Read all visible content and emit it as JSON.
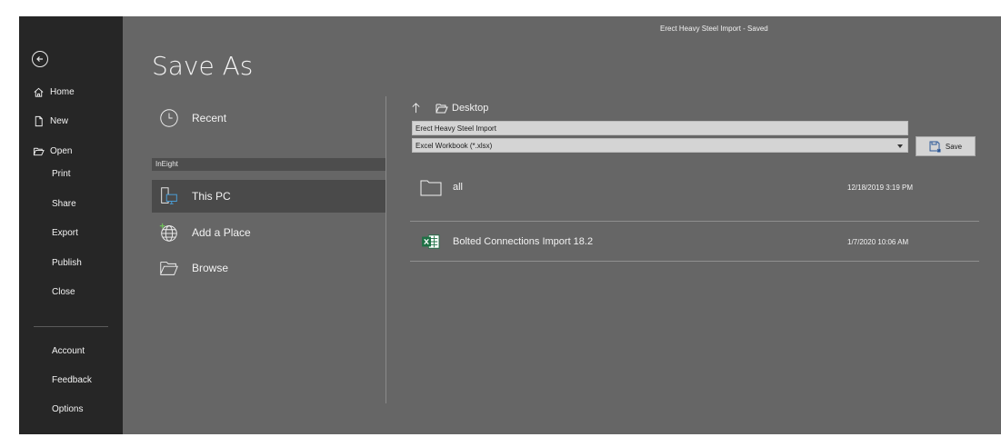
{
  "window": {
    "title": "Erect Heavy Steel Import  -  Saved"
  },
  "nav": {
    "back_icon": "back-arrow-icon",
    "items": [
      {
        "label": "Home",
        "icon": "home-icon"
      },
      {
        "label": "New",
        "icon": "new-document-icon"
      },
      {
        "label": "Open",
        "icon": "open-folder-icon"
      },
      {
        "label": "Print"
      },
      {
        "label": "Share"
      },
      {
        "label": "Export"
      },
      {
        "label": "Publish"
      },
      {
        "label": "Close"
      }
    ],
    "bottom_items": [
      {
        "label": "Account"
      },
      {
        "label": "Feedback"
      },
      {
        "label": "Options"
      }
    ]
  },
  "page": {
    "title": "Save As"
  },
  "locations": {
    "recent": {
      "label": "Recent",
      "icon": "clock-icon"
    },
    "group_header": "InEight",
    "this_pc": {
      "label": "This PC",
      "icon": "pc-icon",
      "selected": true
    },
    "add_place": {
      "label": "Add a Place",
      "icon": "globe-add-icon"
    },
    "browse": {
      "label": "Browse",
      "icon": "folder-browse-icon"
    }
  },
  "file_pane": {
    "path_label": "Desktop",
    "filename_value": "Erect Heavy Steel Import",
    "filetype_value": "Excel Workbook (*.xlsx)",
    "save_label": "Save",
    "files": [
      {
        "name": "all",
        "date": "12/18/2019 3:19 PM",
        "icon": "folder-icon"
      },
      {
        "name": "Bolted Connections Import 18.2",
        "date": "1/7/2020 10:06 AM",
        "icon": "excel-file-icon"
      }
    ]
  },
  "colors": {
    "nav_bg": "#262626",
    "content_bg": "#666666",
    "selected_bg": "#4a4a4a",
    "field_bg": "#d4d4d4",
    "excel_green": "#1e7145"
  }
}
